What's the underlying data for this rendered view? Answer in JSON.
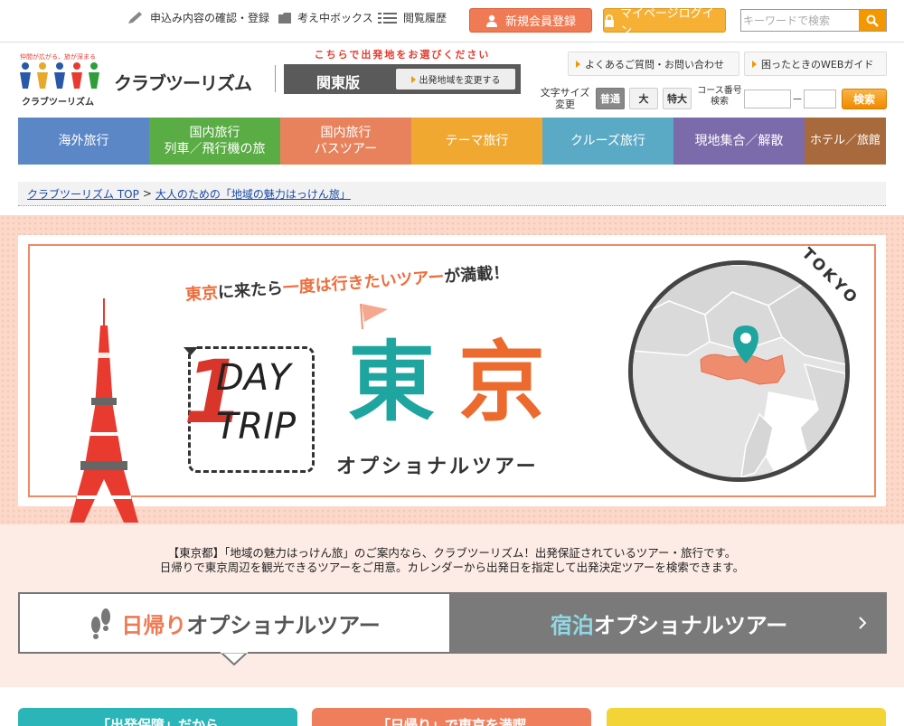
{
  "topbar": {
    "links": [
      "申込み内容の確認・登録",
      "考え中ボックス",
      "閲覧履歴"
    ],
    "register_label": "新規会員登録",
    "login_label": "マイページログイン",
    "search_placeholder": "キーワードで検索"
  },
  "logo": {
    "tagline": "仲間が広がる、旅が深まる",
    "name": "クラブツーリズム",
    "sub": "クラブツーリズム"
  },
  "region": {
    "hint": "こちらで出発地をお選びください",
    "current": "関東版",
    "change_label": "出発地域を変更する"
  },
  "help_links": [
    "よくあるご質問・お問い合わせ",
    "困ったときのWEBガイド"
  ],
  "font_size": {
    "label": "文字サイズ変更",
    "options": [
      "普通",
      "大",
      "特大"
    ],
    "selected": "普通"
  },
  "course_search": {
    "label": "コース番号検索",
    "dash": "－",
    "button": "検索"
  },
  "nav": [
    {
      "label": "海外旅行",
      "color": "#5b87c6"
    },
    {
      "label": "国内旅行\n列車／飛行機の旅",
      "color": "#5aac44"
    },
    {
      "label": "国内旅行\nバスツアー",
      "color": "#e8825d"
    },
    {
      "label": "テーマ旅行",
      "color": "#f0a830"
    },
    {
      "label": "クルーズ旅行",
      "color": "#5aaac6"
    },
    {
      "label": "現地集合／解散",
      "color": "#7b6bab"
    },
    {
      "label": "ホテル／旅館",
      "color": "#a86a3c"
    }
  ],
  "breadcrumb": {
    "home": "クラブツーリズム TOP",
    "sep": ">",
    "current": "大人のための「地域の魅力はっけん旅」"
  },
  "banner": {
    "catch_a": "東京",
    "catch_b": "に来たら",
    "catch_c": "一度は行きたいツアー",
    "catch_d": "が満載！",
    "day": "DAY",
    "trip": "TRIP",
    "title_1": "東",
    "title_2": "京",
    "subtitle": "オプショナルツアー",
    "map_label": "TOKYO"
  },
  "intro": {
    "line1": "【東京都】「地域の魅力はっけん旅」のご案内なら、クラブツーリズム！出発保証されているツアー・旅行です。",
    "line2": "日帰りで東京周辺を観光できるツアーをご用意。カレンダーから出発日を指定して出発決定ツアーを検索できます。"
  },
  "tabs": {
    "day_em": "日帰り",
    "day_rest": "オプショナルツアー",
    "stay_em": "宿泊",
    "stay_rest": "オプショナルツアー"
  },
  "cards": [
    {
      "label": "「出発保障」だから",
      "color": "#2bb5b8"
    },
    {
      "label": "「日帰り」で東京を満喫",
      "color": "#ef7f5c"
    },
    {
      "label": "",
      "color": "#f3d436"
    }
  ]
}
